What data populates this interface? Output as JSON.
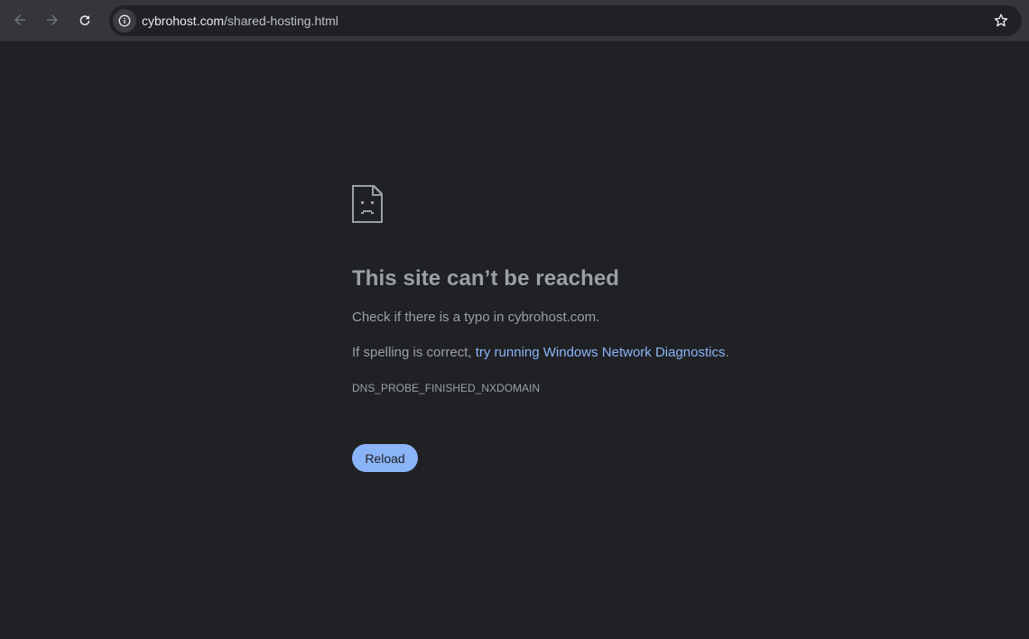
{
  "browser": {
    "url_host": "cybrohost.com",
    "url_path": "/shared-hosting.html",
    "icons": {
      "back": "back-arrow-icon",
      "forward": "forward-arrow-icon",
      "reload": "reload-icon",
      "site_info": "info-icon",
      "bookmark": "star-icon"
    }
  },
  "error_page": {
    "icon": "sad-page-icon",
    "title": "This site can’t be reached",
    "typo_hint": "Check if there is a typo in cybrohost.com.",
    "spelling_prefix": "If spelling is correct, ",
    "diagnostics_link": "try running Windows Network Diagnostics",
    "spelling_suffix": ".",
    "error_code": "DNS_PROBE_FINISHED_NXDOMAIN",
    "reload_label": "Reload"
  },
  "colors": {
    "page_bg": "#202124",
    "toolbar_bg": "#35363a",
    "text_secondary": "#9aa0a6",
    "link": "#8ab4f8",
    "button_bg": "#8ab4f8"
  }
}
